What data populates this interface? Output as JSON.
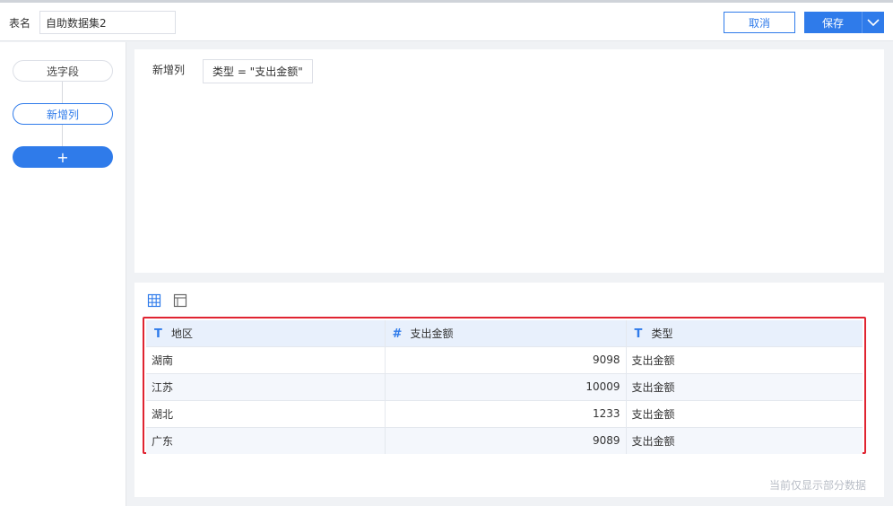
{
  "header": {
    "name_label": "表名",
    "name_value": "自助数据集2",
    "cancel_label": "取消",
    "save_label": "保存"
  },
  "sidebar": {
    "nodes": [
      {
        "label": "选字段"
      },
      {
        "label": "新增列"
      },
      {
        "label": "+"
      }
    ]
  },
  "config": {
    "label": "新增列",
    "formula": "类型 = \"支出金额\""
  },
  "table": {
    "columns": [
      {
        "type_icon": "T",
        "label": "地区"
      },
      {
        "type_icon": "#",
        "label": "支出金额"
      },
      {
        "type_icon": "T",
        "label": "类型"
      }
    ],
    "rows": [
      [
        "湖南",
        "9098",
        "支出金额"
      ],
      [
        "江苏",
        "10009",
        "支出金额"
      ],
      [
        "湖北",
        "1233",
        "支出金额"
      ],
      [
        "广东",
        "9089",
        "支出金额"
      ]
    ]
  },
  "footnote": "当前仅显示部分数据",
  "colors": {
    "accent": "#2f7bea",
    "highlight_border": "#e02431",
    "header_row": "#e8f0fc"
  },
  "icons": {
    "table_view": "grid-table-icon",
    "card_view": "card-layout-icon",
    "save_menu": "chevron-down-icon"
  }
}
